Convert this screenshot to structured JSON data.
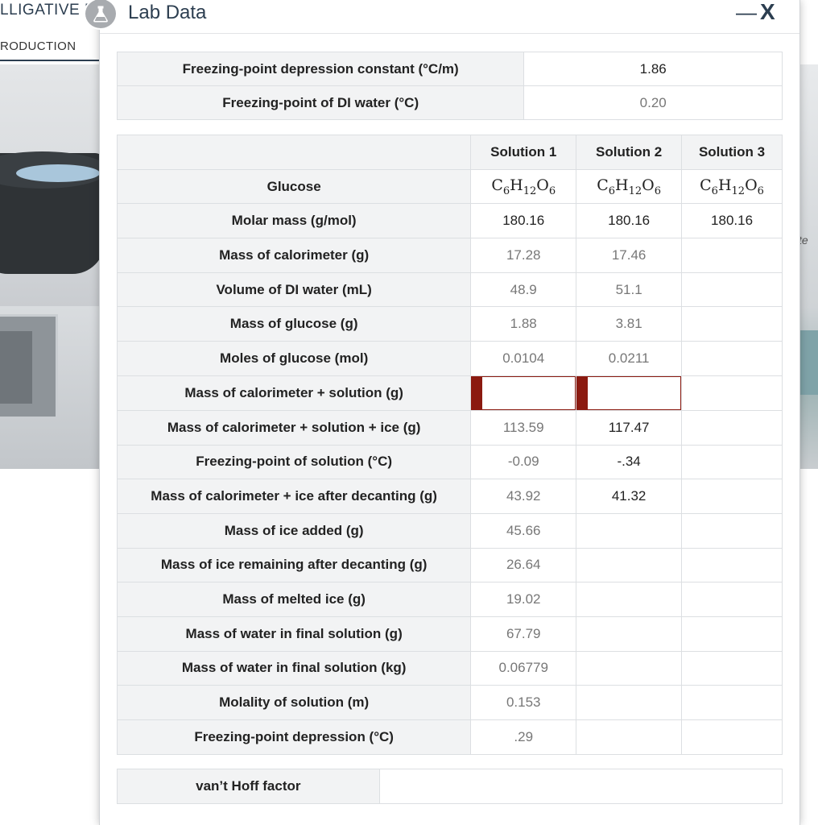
{
  "app": {
    "title": "LLIGATIVE P",
    "tab": "RODUCTION",
    "scene_text": "te"
  },
  "dialog": {
    "title": "Lab Data",
    "minimize_label": "—",
    "close_label": "X",
    "flask_icon": "flask-icon"
  },
  "constants": [
    {
      "label": "Freezing-point depression constant (°C/m)",
      "value": "1.86"
    },
    {
      "label": "Freezing-point of DI water (°C)",
      "value": "0.20"
    }
  ],
  "solutions": {
    "headers": [
      "",
      "Solution 1",
      "Solution 2",
      "Solution 3"
    ],
    "rows": [
      {
        "label": "Glucose",
        "values": [
          "C6H12O6",
          "C6H12O6",
          "C6H12O6"
        ]
      },
      {
        "label": "Molar mass (g/mol)",
        "values": [
          "180.16",
          "180.16",
          "180.16"
        ]
      },
      {
        "label": "Mass of calorimeter (g)",
        "values": [
          "17.28",
          "17.46",
          ""
        ]
      },
      {
        "label": "Volume of DI water (mL)",
        "values": [
          "48.9",
          "51.1",
          ""
        ]
      },
      {
        "label": "Mass of glucose (g)",
        "values": [
          "1.88",
          "3.81",
          ""
        ]
      },
      {
        "label": "Moles of glucose (mol)",
        "values": [
          "0.0104",
          "0.0211",
          ""
        ]
      },
      {
        "label": "Mass of calorimeter + solution (g)",
        "values": [
          "",
          "",
          ""
        ]
      },
      {
        "label": "Mass of calorimeter + solution + ice (g)",
        "values": [
          "113.59",
          "117.47",
          ""
        ]
      },
      {
        "label": "Freezing-point of solution (°C)",
        "values": [
          "-0.09",
          "-.34",
          ""
        ]
      },
      {
        "label": "Mass of calorimeter + ice after decanting (g)",
        "values": [
          "43.92",
          "41.32",
          ""
        ]
      },
      {
        "label": "Mass of ice added (g)",
        "values": [
          "45.66",
          "",
          ""
        ]
      },
      {
        "label": "Mass of ice remaining after decanting (g)",
        "values": [
          "26.64",
          "",
          ""
        ]
      },
      {
        "label": "Mass of melted ice (g)",
        "values": [
          "19.02",
          "",
          ""
        ]
      },
      {
        "label": "Mass of water in final solution (g)",
        "values": [
          "67.79",
          "",
          ""
        ]
      },
      {
        "label": "Mass of water in final solution (kg)",
        "values": [
          "0.06779",
          "",
          ""
        ]
      },
      {
        "label": "Molality of solution (m)",
        "values": [
          "0.153",
          "",
          ""
        ]
      },
      {
        "label": "Freezing-point depression (°C)",
        "values": [
          ".29",
          "",
          ""
        ]
      }
    ]
  },
  "vant_hoff": {
    "label": "van’t Hoff factor",
    "value": ""
  }
}
